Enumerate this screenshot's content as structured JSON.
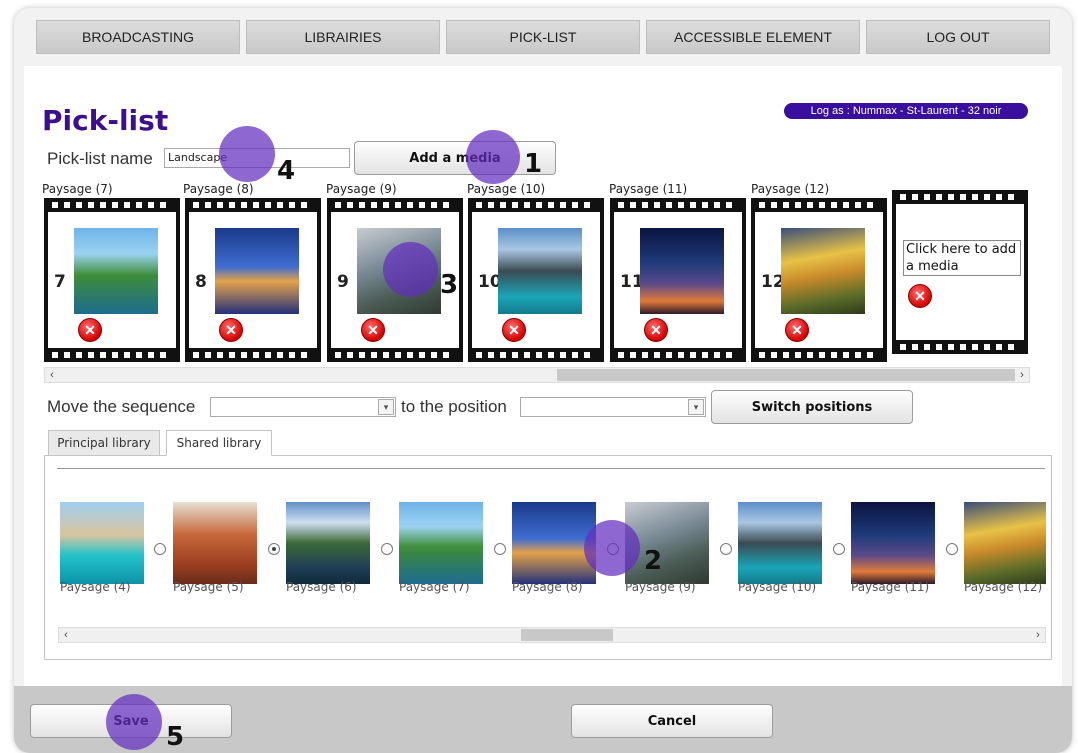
{
  "nav": [
    "BROADCASTING",
    "LIBRAIRIES",
    "PICK-LIST",
    "ACCESSIBLE ELEMENT",
    "LOG OUT"
  ],
  "title": "Pick-list",
  "login_badge": "Log as : Nummax - St-Laurent - 32 noir",
  "name_label": "Pick-list name",
  "name_value": "Landscape",
  "add_media": "Add a media",
  "sequence": [
    {
      "caption": "Paysage (7)",
      "num": "7"
    },
    {
      "caption": "Paysage (8)",
      "num": "8"
    },
    {
      "caption": "Paysage (9)",
      "num": "9"
    },
    {
      "caption": "Paysage (10)",
      "num": "10"
    },
    {
      "caption": "Paysage (11)",
      "num": "11"
    },
    {
      "caption": "Paysage (12)",
      "num": "12"
    }
  ],
  "add_cell": "Click here to add a media",
  "move_label": "Move the sequence",
  "to_label": "to the position",
  "switch_label": "Switch positions",
  "tabs": [
    "Principal library",
    "Shared library"
  ],
  "library": [
    "Paysage (4)",
    "Paysage (5)",
    "Paysage (6)",
    "Paysage (7)",
    "Paysage (8)",
    "Paysage (9)",
    "Paysage (10)",
    "Paysage (11)",
    "Paysage (12)"
  ],
  "library_selected": "Paysage (6)",
  "save": "Save",
  "cancel": "Cancel",
  "markers": [
    "1",
    "2",
    "3",
    "4",
    "5"
  ],
  "colors": {
    "title": "#3b0f8f",
    "marker": "#622ebe",
    "badge": "#3b0f9e"
  }
}
